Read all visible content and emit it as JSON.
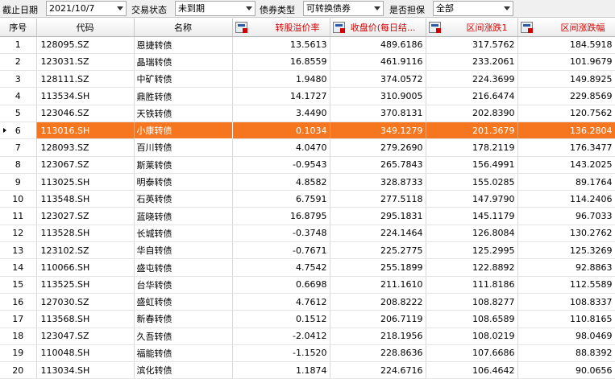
{
  "filters": [
    {
      "label": "截止日期",
      "value": "2021/10/7"
    },
    {
      "label": "交易状态",
      "value": "未到期"
    },
    {
      "label": "债券类型",
      "value": "可转换债券"
    },
    {
      "label": "是否担保",
      "value": "全部"
    }
  ],
  "columns": {
    "index": "序号",
    "code": "代码",
    "name": "名称",
    "premium": "转股溢价率",
    "close": "收盘价(每日结...",
    "change1": "区间涨跌1",
    "change": "区间涨跌幅"
  },
  "selected_row": 5,
  "rows": [
    {
      "idx": "1",
      "code": "128095.SZ",
      "name": "恩捷转债",
      "premium": "13.5613",
      "close": "489.6186",
      "change1": "317.5762",
      "change": "184.5918"
    },
    {
      "idx": "2",
      "code": "123031.SZ",
      "name": "晶瑞转债",
      "premium": "16.8559",
      "close": "461.9116",
      "change1": "233.2061",
      "change": "101.9679"
    },
    {
      "idx": "3",
      "code": "128111.SZ",
      "name": "中矿转债",
      "premium": "1.9480",
      "close": "374.0572",
      "change1": "224.3699",
      "change": "149.8925"
    },
    {
      "idx": "4",
      "code": "113534.SH",
      "name": "鼎胜转债",
      "premium": "14.1727",
      "close": "310.9005",
      "change1": "216.6474",
      "change": "229.8569"
    },
    {
      "idx": "5",
      "code": "123046.SZ",
      "name": "天铁转债",
      "premium": "3.4490",
      "close": "370.8131",
      "change1": "202.8390",
      "change": "120.7562"
    },
    {
      "idx": "6",
      "code": "113016.SH",
      "name": "小康转债",
      "premium": "0.1034",
      "close": "349.1279",
      "change1": "201.3679",
      "change": "136.2804"
    },
    {
      "idx": "7",
      "code": "128093.SZ",
      "name": "百川转债",
      "premium": "4.0470",
      "close": "279.2690",
      "change1": "178.2119",
      "change": "176.3477"
    },
    {
      "idx": "8",
      "code": "123067.SZ",
      "name": "斯莱转债",
      "premium": "-0.9543",
      "close": "265.7843",
      "change1": "156.4991",
      "change": "143.2025"
    },
    {
      "idx": "9",
      "code": "113025.SH",
      "name": "明泰转债",
      "premium": "4.8582",
      "close": "328.8733",
      "change1": "155.0285",
      "change": "89.1764"
    },
    {
      "idx": "10",
      "code": "113548.SH",
      "name": "石英转债",
      "premium": "6.7591",
      "close": "277.5118",
      "change1": "147.9790",
      "change": "114.2406"
    },
    {
      "idx": "11",
      "code": "123027.SZ",
      "name": "蓝晓转债",
      "premium": "16.8795",
      "close": "295.1831",
      "change1": "145.1179",
      "change": "96.7033"
    },
    {
      "idx": "12",
      "code": "113528.SH",
      "name": "长城转债",
      "premium": "-0.3748",
      "close": "224.1464",
      "change1": "126.8084",
      "change": "130.2762"
    },
    {
      "idx": "13",
      "code": "123102.SZ",
      "name": "华自转债",
      "premium": "-0.7671",
      "close": "225.2775",
      "change1": "125.2995",
      "change": "125.3269"
    },
    {
      "idx": "14",
      "code": "110066.SH",
      "name": "盛屯转债",
      "premium": "4.7542",
      "close": "255.1899",
      "change1": "122.8892",
      "change": "92.8863"
    },
    {
      "idx": "15",
      "code": "113525.SH",
      "name": "台华转债",
      "premium": "0.6698",
      "close": "211.1610",
      "change1": "111.8186",
      "change": "112.5589"
    },
    {
      "idx": "16",
      "code": "127030.SZ",
      "name": "盛虹转债",
      "premium": "4.7612",
      "close": "208.8222",
      "change1": "108.8277",
      "change": "108.8337"
    },
    {
      "idx": "17",
      "code": "113568.SH",
      "name": "新春转债",
      "premium": "0.1512",
      "close": "206.7119",
      "change1": "108.6589",
      "change": "110.8165"
    },
    {
      "idx": "18",
      "code": "123047.SZ",
      "name": "久吾转债",
      "premium": "-2.0412",
      "close": "218.1956",
      "change1": "108.0219",
      "change": "98.0469"
    },
    {
      "idx": "19",
      "code": "110048.SH",
      "name": "福能转债",
      "premium": "-1.1520",
      "close": "228.8636",
      "change1": "107.6686",
      "change": "88.8392"
    },
    {
      "idx": "20",
      "code": "113034.SH",
      "name": "滨化转债",
      "premium": "1.1874",
      "close": "224.6716",
      "change1": "106.4642",
      "change": "90.0656"
    }
  ]
}
